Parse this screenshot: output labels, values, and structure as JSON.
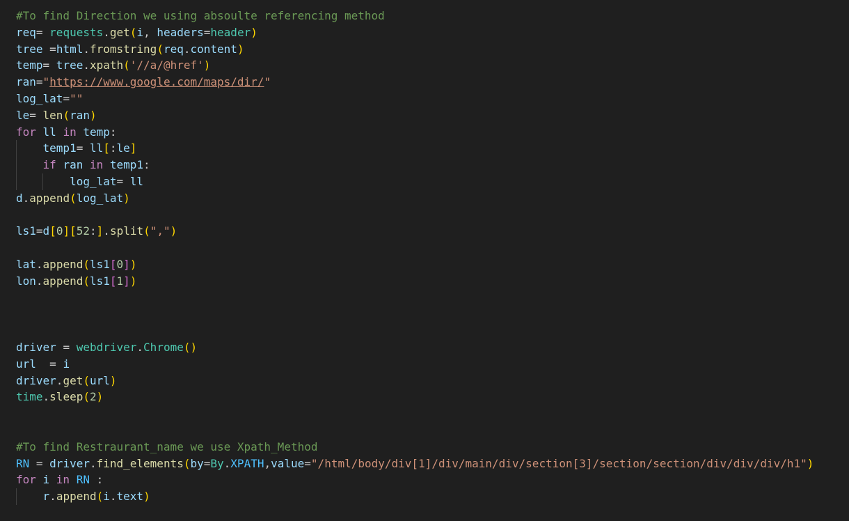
{
  "editor": {
    "lines": [
      [
        {
          "t": "#To find Direction we using absoulte referencing method",
          "c": "comment"
        }
      ],
      [
        {
          "t": "req",
          "c": "var"
        },
        {
          "t": "= ",
          "c": "op"
        },
        {
          "t": "requests",
          "c": "mod"
        },
        {
          "t": ".",
          "c": "op"
        },
        {
          "t": "get",
          "c": "func"
        },
        {
          "t": "(",
          "c": "b1"
        },
        {
          "t": "i",
          "c": "var"
        },
        {
          "t": ", ",
          "c": "op"
        },
        {
          "t": "headers",
          "c": "var"
        },
        {
          "t": "=",
          "c": "op"
        },
        {
          "t": "header",
          "c": "mod"
        },
        {
          "t": ")",
          "c": "b1"
        }
      ],
      [
        {
          "t": "tree ",
          "c": "var"
        },
        {
          "t": "=",
          "c": "op"
        },
        {
          "t": "html",
          "c": "var"
        },
        {
          "t": ".",
          "c": "op"
        },
        {
          "t": "fromstring",
          "c": "func"
        },
        {
          "t": "(",
          "c": "b1"
        },
        {
          "t": "req",
          "c": "var"
        },
        {
          "t": ".",
          "c": "op"
        },
        {
          "t": "content",
          "c": "var"
        },
        {
          "t": ")",
          "c": "b1"
        }
      ],
      [
        {
          "t": "temp",
          "c": "var"
        },
        {
          "t": "= ",
          "c": "op"
        },
        {
          "t": "tree",
          "c": "var"
        },
        {
          "t": ".",
          "c": "op"
        },
        {
          "t": "xpath",
          "c": "func"
        },
        {
          "t": "(",
          "c": "b1"
        },
        {
          "t": "'//a/@href'",
          "c": "str"
        },
        {
          "t": ")",
          "c": "b1"
        }
      ],
      [
        {
          "t": "ran",
          "c": "var"
        },
        {
          "t": "=",
          "c": "op"
        },
        {
          "t": "\"",
          "c": "str"
        },
        {
          "t": "https://www.google.com/maps/dir/",
          "c": "url"
        },
        {
          "t": "\"",
          "c": "str"
        }
      ],
      [
        {
          "t": "log_lat",
          "c": "var"
        },
        {
          "t": "=",
          "c": "op"
        },
        {
          "t": "\"\"",
          "c": "str"
        }
      ],
      [
        {
          "t": "le",
          "c": "var"
        },
        {
          "t": "= ",
          "c": "op"
        },
        {
          "t": "len",
          "c": "func"
        },
        {
          "t": "(",
          "c": "b1"
        },
        {
          "t": "ran",
          "c": "var"
        },
        {
          "t": ")",
          "c": "b1"
        }
      ],
      [
        {
          "t": "for ",
          "c": "kw"
        },
        {
          "t": "ll ",
          "c": "var"
        },
        {
          "t": "in ",
          "c": "kw"
        },
        {
          "t": "temp",
          "c": "var"
        },
        {
          "t": ":",
          "c": "op"
        }
      ],
      [
        {
          "t": "    ",
          "c": "plain"
        },
        {
          "t": "temp1",
          "c": "var"
        },
        {
          "t": "= ",
          "c": "op"
        },
        {
          "t": "ll",
          "c": "var"
        },
        {
          "t": "[",
          "c": "b1"
        },
        {
          "t": ":",
          "c": "op"
        },
        {
          "t": "le",
          "c": "var"
        },
        {
          "t": "]",
          "c": "b1"
        }
      ],
      [
        {
          "t": "    ",
          "c": "plain"
        },
        {
          "t": "if ",
          "c": "kw"
        },
        {
          "t": "ran ",
          "c": "var"
        },
        {
          "t": "in ",
          "c": "kw"
        },
        {
          "t": "temp1",
          "c": "var"
        },
        {
          "t": ":",
          "c": "op"
        }
      ],
      [
        {
          "t": "        ",
          "c": "plain"
        },
        {
          "t": "log_lat",
          "c": "var"
        },
        {
          "t": "= ",
          "c": "op"
        },
        {
          "t": "ll",
          "c": "var"
        }
      ],
      [
        {
          "t": "d",
          "c": "var"
        },
        {
          "t": ".",
          "c": "op"
        },
        {
          "t": "append",
          "c": "func"
        },
        {
          "t": "(",
          "c": "b1"
        },
        {
          "t": "log_lat",
          "c": "var"
        },
        {
          "t": ")",
          "c": "b1"
        }
      ],
      [],
      [
        {
          "t": "ls1",
          "c": "var"
        },
        {
          "t": "=",
          "c": "op"
        },
        {
          "t": "d",
          "c": "var"
        },
        {
          "t": "[",
          "c": "b1"
        },
        {
          "t": "0",
          "c": "num"
        },
        {
          "t": "]",
          "c": "b1"
        },
        {
          "t": "[",
          "c": "b1"
        },
        {
          "t": "52",
          "c": "num"
        },
        {
          "t": ":",
          "c": "op"
        },
        {
          "t": "]",
          "c": "b1"
        },
        {
          "t": ".",
          "c": "op"
        },
        {
          "t": "split",
          "c": "func"
        },
        {
          "t": "(",
          "c": "b1"
        },
        {
          "t": "\",\"",
          "c": "str"
        },
        {
          "t": ")",
          "c": "b1"
        }
      ],
      [],
      [
        {
          "t": "lat",
          "c": "var"
        },
        {
          "t": ".",
          "c": "op"
        },
        {
          "t": "append",
          "c": "func"
        },
        {
          "t": "(",
          "c": "b1"
        },
        {
          "t": "ls1",
          "c": "var"
        },
        {
          "t": "[",
          "c": "b2"
        },
        {
          "t": "0",
          "c": "num"
        },
        {
          "t": "]",
          "c": "b2"
        },
        {
          "t": ")",
          "c": "b1"
        }
      ],
      [
        {
          "t": "lon",
          "c": "var"
        },
        {
          "t": ".",
          "c": "op"
        },
        {
          "t": "append",
          "c": "func"
        },
        {
          "t": "(",
          "c": "b1"
        },
        {
          "t": "ls1",
          "c": "var"
        },
        {
          "t": "[",
          "c": "b2"
        },
        {
          "t": "1",
          "c": "num"
        },
        {
          "t": "]",
          "c": "b2"
        },
        {
          "t": ")",
          "c": "b1"
        }
      ],
      [],
      [],
      [],
      [
        {
          "t": "driver ",
          "c": "var"
        },
        {
          "t": "= ",
          "c": "op"
        },
        {
          "t": "webdriver",
          "c": "mod"
        },
        {
          "t": ".",
          "c": "op"
        },
        {
          "t": "Chrome",
          "c": "class"
        },
        {
          "t": "()",
          "c": "b1"
        }
      ],
      [
        {
          "t": "url  ",
          "c": "var"
        },
        {
          "t": "= ",
          "c": "op"
        },
        {
          "t": "i",
          "c": "var"
        }
      ],
      [
        {
          "t": "driver",
          "c": "var"
        },
        {
          "t": ".",
          "c": "op"
        },
        {
          "t": "get",
          "c": "func"
        },
        {
          "t": "(",
          "c": "b1"
        },
        {
          "t": "url",
          "c": "var"
        },
        {
          "t": ")",
          "c": "b1"
        }
      ],
      [
        {
          "t": "time",
          "c": "mod"
        },
        {
          "t": ".",
          "c": "op"
        },
        {
          "t": "sleep",
          "c": "func"
        },
        {
          "t": "(",
          "c": "b1"
        },
        {
          "t": "2",
          "c": "num"
        },
        {
          "t": ")",
          "c": "b1"
        }
      ],
      [],
      [],
      [
        {
          "t": "#To find Restraurant_name we use Xpath_Method",
          "c": "comment"
        }
      ],
      [
        {
          "t": "RN ",
          "c": "const"
        },
        {
          "t": "= ",
          "c": "op"
        },
        {
          "t": "driver",
          "c": "var"
        },
        {
          "t": ".",
          "c": "op"
        },
        {
          "t": "find_elements",
          "c": "func"
        },
        {
          "t": "(",
          "c": "b1"
        },
        {
          "t": "by",
          "c": "var"
        },
        {
          "t": "=",
          "c": "op"
        },
        {
          "t": "By",
          "c": "class"
        },
        {
          "t": ".",
          "c": "op"
        },
        {
          "t": "XPATH",
          "c": "const"
        },
        {
          "t": ",",
          "c": "op"
        },
        {
          "t": "value",
          "c": "var"
        },
        {
          "t": "=",
          "c": "op"
        },
        {
          "t": "\"/html/body/div[1]/div/main/div/section[3]/section/section/div/div/div/h1\"",
          "c": "str"
        },
        {
          "t": ")",
          "c": "b1"
        }
      ],
      [
        {
          "t": "for ",
          "c": "kw"
        },
        {
          "t": "i ",
          "c": "var"
        },
        {
          "t": "in ",
          "c": "kw"
        },
        {
          "t": "RN ",
          "c": "const"
        },
        {
          "t": ":",
          "c": "op"
        }
      ],
      [
        {
          "t": "    ",
          "c": "plain"
        },
        {
          "t": "r",
          "c": "var"
        },
        {
          "t": ".",
          "c": "op"
        },
        {
          "t": "append",
          "c": "func"
        },
        {
          "t": "(",
          "c": "b1"
        },
        {
          "t": "i",
          "c": "var"
        },
        {
          "t": ".",
          "c": "op"
        },
        {
          "t": "text",
          "c": "var"
        },
        {
          "t": ")",
          "c": "b1"
        }
      ]
    ]
  },
  "colors": {
    "background": "#1f1f1f",
    "comment": "#6a9955",
    "variable": "#9cdcfe",
    "function": "#dcdcaa",
    "module": "#4ec9b0",
    "keyword": "#c586c0",
    "string": "#ce9178",
    "number": "#b5cea8",
    "bracket_level1": "#ffd700",
    "bracket_level2": "#da70d6"
  }
}
